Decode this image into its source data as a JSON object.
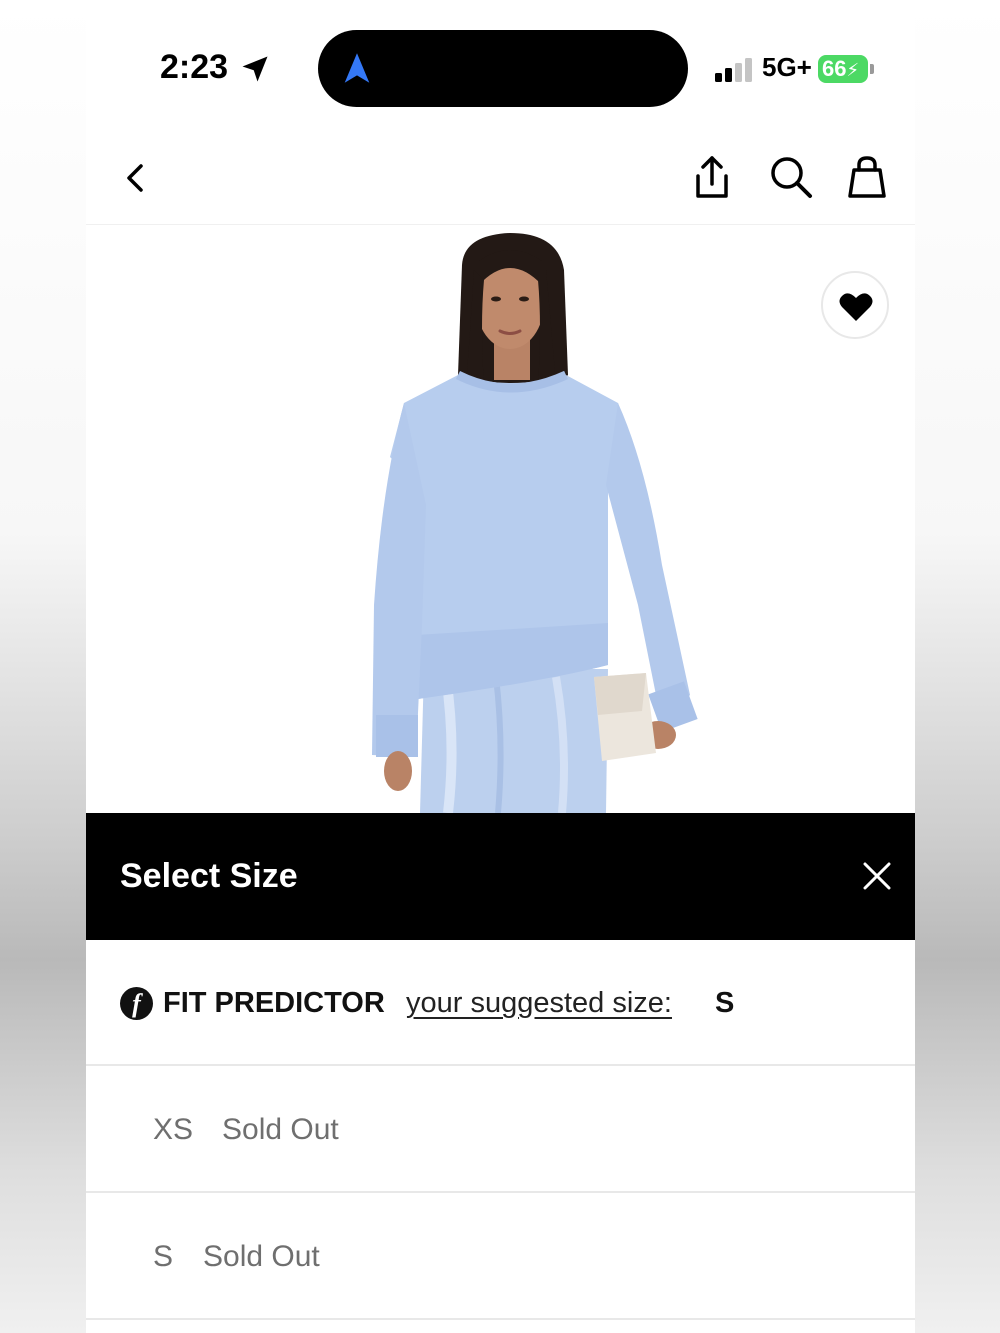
{
  "status_bar": {
    "time": "2:23",
    "network": "5G+",
    "battery": "66"
  },
  "nav": {
    "icons": [
      "back-icon",
      "share-icon",
      "search-icon",
      "bag-icon"
    ]
  },
  "product": {
    "wishlist_icon": "heart-icon",
    "sweater_color": "#b7cdee",
    "skirt_color": "#bcd0ee"
  },
  "size_sheet": {
    "title": "Select Size",
    "fit_predictor": {
      "label": "FIT PREDICTOR",
      "link_text": "your suggested size:",
      "suggested_size": "S"
    },
    "sizes": [
      {
        "size": "XS",
        "status": "Sold Out"
      },
      {
        "size": "S",
        "status": "Sold Out"
      }
    ]
  },
  "colors": {
    "sheet_header_bg": "#000000",
    "battery_green": "#4cd964",
    "nav_accent": "#3478f6"
  }
}
